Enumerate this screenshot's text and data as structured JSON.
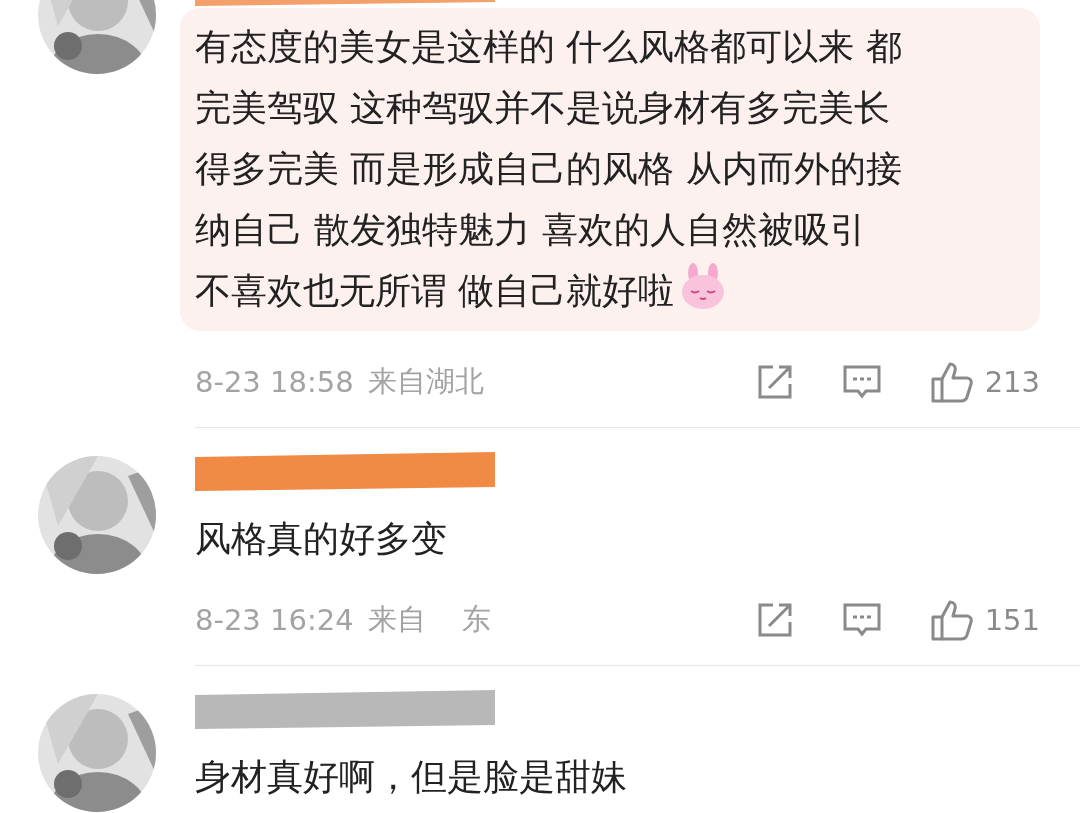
{
  "comments": [
    {
      "avatar": {
        "kind": "picture"
      },
      "name_scribble": {
        "color": "#f4a06a"
      },
      "bubble": true,
      "text_lines": [
        "有态度的美女是这样的 什么风格都可以来 都",
        "完美驾驭 这种驾驭并不是说身材有多完美长",
        "得多完美 而是形成自己的风格 从内而外的接",
        "纳自己 散发独特魅力 喜欢的人自然被吸引",
        "不喜欢也无所谓 做自己就好啦"
      ],
      "emoji": true,
      "time": "8-23 18:58",
      "location": [
        "来自湖北"
      ],
      "likes": "213"
    },
    {
      "avatar": {
        "kind": "picture"
      },
      "name_scribble": {
        "color": "#f08a45"
      },
      "text_lines": [
        "风格真的好多变"
      ],
      "time": "8-23 16:24",
      "location": [
        "来自",
        "东"
      ],
      "likes": "151"
    },
    {
      "avatar": {
        "kind": "picture"
      },
      "name_scribble": {
        "color": "#b8b8b8"
      },
      "text_lines": [
        "身材真好啊，但是脸是甜妹"
      ]
    }
  ]
}
